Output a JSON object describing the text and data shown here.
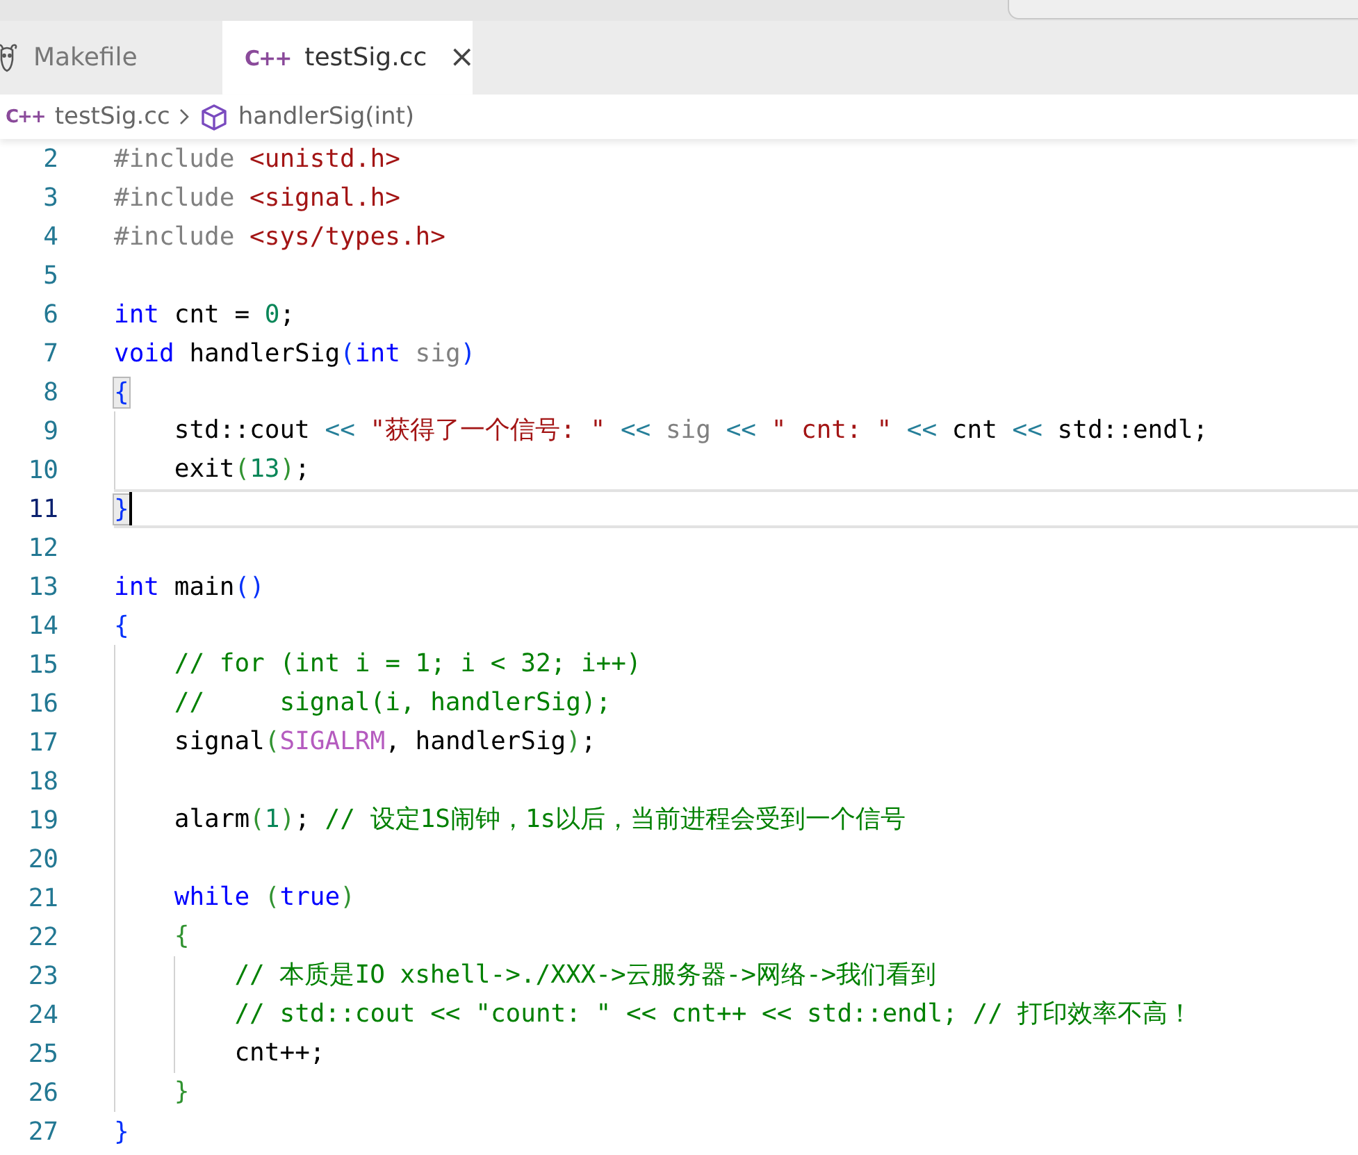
{
  "tabs": [
    {
      "kind": "makefile",
      "label": "Makefile",
      "selected": false
    },
    {
      "kind": "cpp",
      "icon": "C++",
      "label": "testSig.cc",
      "selected": true,
      "close": "×"
    }
  ],
  "breadcrumb": {
    "file_icon": "C++",
    "file": "testSig.cc",
    "symbol": "handlerSig(int)"
  },
  "lines": [
    {
      "number": "2",
      "current": false,
      "tokens": [
        {
          "text": "#include",
          "kind": "directive"
        },
        {
          "text": " <unistd.h>",
          "kind": "header"
        }
      ]
    },
    {
      "number": "3",
      "current": false,
      "tokens": [
        {
          "text": "#include",
          "kind": "directive"
        },
        {
          "text": " <signal.h>",
          "kind": "header"
        }
      ]
    },
    {
      "number": "4",
      "current": false,
      "tokens": [
        {
          "text": "#include",
          "kind": "directive"
        },
        {
          "text": " <sys/types.h>",
          "kind": "header"
        }
      ]
    },
    {
      "number": "5",
      "current": false
    },
    {
      "number": "6",
      "current": false,
      "tokens": [
        {
          "text": "int",
          "kind": "keyword"
        },
        {
          "text": " cnt = ",
          "kind": "plain"
        },
        {
          "text": "0",
          "kind": "number"
        },
        {
          "text": ";",
          "kind": "plain"
        }
      ]
    },
    {
      "number": "7",
      "current": false,
      "tokens": [
        {
          "text": "void",
          "kind": "keyword"
        },
        {
          "text": " handlerSig",
          "kind": "plain"
        },
        {
          "text": "(",
          "kind": "bracket1"
        },
        {
          "text": "int",
          "kind": "keyword"
        },
        {
          "text": " sig",
          "kind": "param"
        },
        {
          "text": ")",
          "kind": "bracket1"
        }
      ]
    },
    {
      "number": "8",
      "current": false,
      "tokens": [
        {
          "text": "{",
          "kind": "bracket1",
          "matched": true
        }
      ]
    },
    {
      "number": "9",
      "current": false,
      "tokens": [
        {
          "text": "    std::cout ",
          "kind": "plain"
        },
        {
          "text": "<<",
          "kind": "operator"
        },
        {
          "text": " \"获得了一个信号: \"",
          "kind": "string"
        },
        {
          "text": " <<",
          "kind": "operator"
        },
        {
          "text": " sig",
          "kind": "param"
        },
        {
          "text": " <<",
          "kind": "operator"
        },
        {
          "text": " \" cnt: \"",
          "kind": "string"
        },
        {
          "text": " <<",
          "kind": "operator"
        },
        {
          "text": " cnt ",
          "kind": "plain"
        },
        {
          "text": "<<",
          "kind": "operator"
        },
        {
          "text": " std::endl;",
          "kind": "plain"
        }
      ]
    },
    {
      "number": "10",
      "current": false,
      "tokens": [
        {
          "text": "    exit",
          "kind": "plain"
        },
        {
          "text": "(",
          "kind": "bracket2"
        },
        {
          "text": "13",
          "kind": "number"
        },
        {
          "text": ")",
          "kind": "bracket2"
        },
        {
          "text": ";",
          "kind": "plain"
        }
      ]
    },
    {
      "number": "11",
      "current": true,
      "cursor": true,
      "tokens": [
        {
          "text": "}",
          "kind": "bracket1",
          "matched": true
        }
      ]
    },
    {
      "number": "12",
      "current": false
    },
    {
      "number": "13",
      "current": false,
      "tokens": [
        {
          "text": "int",
          "kind": "keyword"
        },
        {
          "text": " main",
          "kind": "plain"
        },
        {
          "text": "()",
          "kind": "bracket1"
        }
      ]
    },
    {
      "number": "14",
      "current": false,
      "tokens": [
        {
          "text": "{",
          "kind": "bracket1"
        }
      ]
    },
    {
      "number": "15",
      "current": false,
      "tokens": [
        {
          "text": "    // for (int i = 1; i < 32; i++)",
          "kind": "comment"
        }
      ]
    },
    {
      "number": "16",
      "current": false,
      "tokens": [
        {
          "text": "    //     signal(i, handlerSig);",
          "kind": "comment"
        }
      ]
    },
    {
      "number": "17",
      "current": false,
      "tokens": [
        {
          "text": "    signal",
          "kind": "plain"
        },
        {
          "text": "(",
          "kind": "bracket2"
        },
        {
          "text": "SIGALRM",
          "kind": "macro"
        },
        {
          "text": ", handlerSig",
          "kind": "plain"
        },
        {
          "text": ")",
          "kind": "bracket2"
        },
        {
          "text": ";",
          "kind": "plain"
        }
      ]
    },
    {
      "number": "18",
      "current": false
    },
    {
      "number": "19",
      "current": false,
      "tokens": [
        {
          "text": "    alarm",
          "kind": "plain"
        },
        {
          "text": "(",
          "kind": "bracket2"
        },
        {
          "text": "1",
          "kind": "number"
        },
        {
          "text": ")",
          "kind": "bracket2"
        },
        {
          "text": "; ",
          "kind": "plain"
        },
        {
          "text": "// 设定1S闹钟，1s以后，当前进程会受到一个信号",
          "kind": "comment"
        }
      ]
    },
    {
      "number": "20",
      "current": false
    },
    {
      "number": "21",
      "current": false,
      "tokens": [
        {
          "text": "    while",
          "kind": "keyword"
        },
        {
          "text": " (",
          "kind": "bracket2"
        },
        {
          "text": "true",
          "kind": "keyword"
        },
        {
          "text": ")",
          "kind": "bracket2"
        }
      ]
    },
    {
      "number": "22",
      "current": false,
      "tokens": [
        {
          "text": "    {",
          "kind": "bracket2"
        }
      ]
    },
    {
      "number": "23",
      "current": false,
      "tokens": [
        {
          "text": "        // 本质是IO xshell->./XXX->云服务器->网络->我们看到",
          "kind": "comment"
        }
      ]
    },
    {
      "number": "24",
      "current": false,
      "tokens": [
        {
          "text": "        // std::cout << \"count: \" << cnt++ << std::endl; // 打印效率不高！",
          "kind": "comment"
        }
      ]
    },
    {
      "number": "25",
      "current": false,
      "tokens": [
        {
          "text": "        cnt++;",
          "kind": "plain"
        }
      ]
    },
    {
      "number": "26",
      "current": false,
      "tokens": [
        {
          "text": "    }",
          "kind": "bracket2"
        }
      ]
    },
    {
      "number": "27",
      "current": false,
      "tokens": [
        {
          "text": "}",
          "kind": "bracket1"
        }
      ]
    }
  ]
}
